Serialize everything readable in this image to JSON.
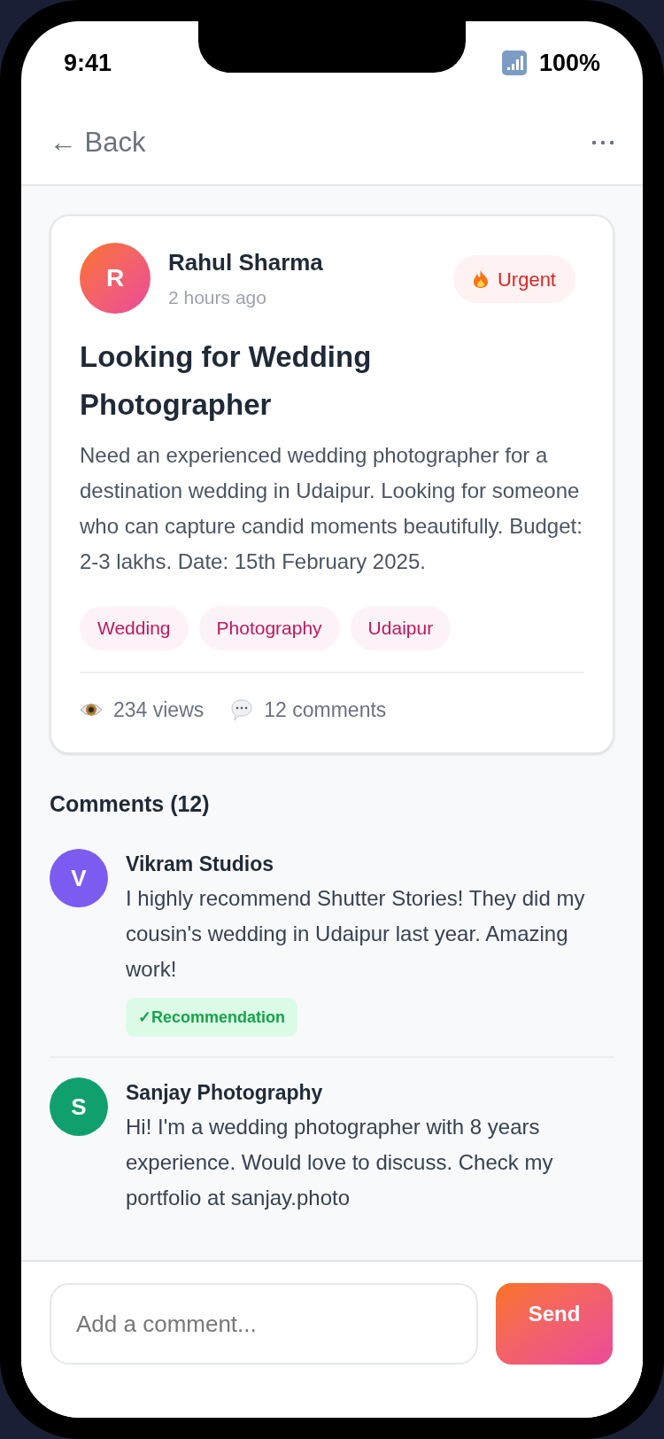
{
  "status_bar": {
    "time": "9:41",
    "battery": "100%"
  },
  "header": {
    "back": "← Back"
  },
  "post": {
    "author": {
      "initial": "R",
      "name": "Rahul Sharma"
    },
    "time": "2 hours ago",
    "priority": {
      "kind": "urgent",
      "label": "Urgent"
    },
    "title": "Looking for Wedding Photographer",
    "body": "Need an experienced wedding photographer for a destination wedding in Udaipur. Looking for someone who can capture candid moments beautifully. Budget: 2-3 lakhs. Date: 15th February 2025.",
    "tags": [
      "Wedding",
      "Photography",
      "Udaipur"
    ],
    "stats": {
      "views": "234 views",
      "comments": "12 comments"
    }
  },
  "comments_heading": "Comments (12)",
  "comments": [
    {
      "initial": "V",
      "color": "#7c5cf0",
      "name": "Vikram Studios",
      "text": "I highly recommend Shutter Stories! They did my cousin's wedding in Udaipur last year. Amazing work!",
      "badge": {
        "kind": "recommendation",
        "label": "✓Recommendation"
      }
    },
    {
      "initial": "S",
      "color": "#10a06e",
      "name": "Sanjay Photography",
      "text": "Hi! I'm a wedding photographer with 8 years experience. Would love to discuss. Check my portfolio at sanjay.photo"
    }
  ],
  "composer": {
    "placeholder": "Add a comment...",
    "send": "Send"
  }
}
